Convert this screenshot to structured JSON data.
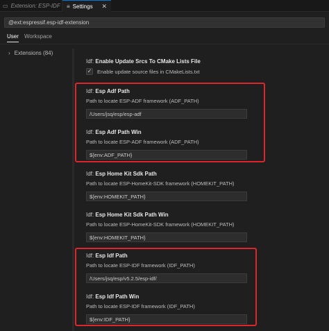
{
  "tabs": [
    {
      "label": "Extension: ESP-IDF",
      "icon": "extension-icon"
    },
    {
      "label": "Settings",
      "icon": "settings-file-icon"
    }
  ],
  "search": {
    "value": "@ext:espressif.esp-idf-extension"
  },
  "scopes": {
    "user": "User",
    "workspace": "Workspace"
  },
  "toc": {
    "label": "Extensions (84)"
  },
  "settings": [
    {
      "category": "Idf:",
      "name": "Enable Update Srcs To CMake Lists File",
      "checkbox_label": "Enable update source files in CMakeLists.txt",
      "checked": true
    },
    {
      "category": "Idf:",
      "name": "Esp Adf Path",
      "desc": "Path to locate ESP-ADF framework (ADF_PATH)",
      "value": "/Users/jsq/esp/esp-adf"
    },
    {
      "category": "Idf:",
      "name": "Esp Adf Path Win",
      "desc": "Path to locate ESP-ADF framework (ADF_PATH)",
      "value": "${env:ADF_PATH}"
    },
    {
      "category": "Idf:",
      "name": "Esp Home Kit Sdk Path",
      "desc": "Path to locate ESP-HomeKit-SDK framework (HOMEKIT_PATH)",
      "value": "${env:HOMEKIT_PATH}"
    },
    {
      "category": "Idf:",
      "name": "Esp Home Kit Sdk Path Win",
      "desc": "Path to locate ESP-HomeKit-SDK framework (HOMEKIT_PATH)",
      "value": "${env:HOMEKIT_PATH}"
    },
    {
      "category": "Idf:",
      "name": "Esp Idf Path",
      "desc": "Path to locate ESP-IDF framework (IDF_PATH)",
      "value": "/Users/jsq/esp/v5.2.5/esp-idf/"
    },
    {
      "category": "Idf:",
      "name": "Esp Idf Path Win",
      "desc": "Path to locate ESP-IDF framework (IDF_PATH)",
      "value": "${env:IDF_PATH}"
    }
  ],
  "colors": {
    "highlight": "#e0262d",
    "accent": "#0078d4"
  }
}
